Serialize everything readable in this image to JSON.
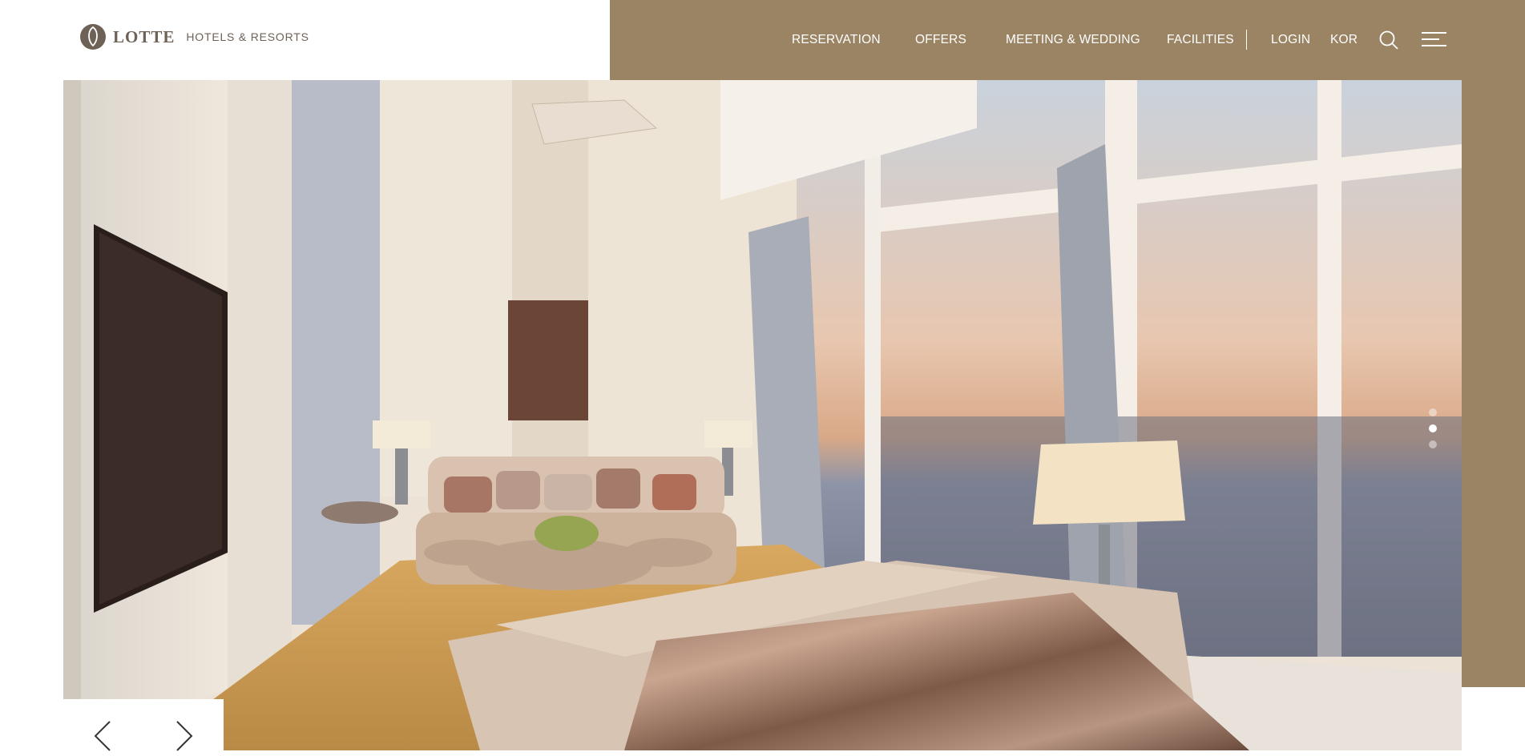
{
  "brand": {
    "name_main": "LOTTE",
    "name_sub": "HOTELS & RESORTS",
    "colors": {
      "panel": "#9b8464",
      "logo": "#6e6257",
      "text_on_panel": "#ffffff"
    }
  },
  "nav": {
    "items": [
      {
        "label": "RESERVATION"
      },
      {
        "label": "OFFERS"
      },
      {
        "label": "MEETING & WEDDING"
      },
      {
        "label": "FACILITIES"
      }
    ],
    "login": "LOGIN",
    "language": "KOR",
    "icons": {
      "search": "search-icon",
      "menu": "hamburger-menu-icon"
    }
  },
  "hero": {
    "image": "hotel-suite-living-room-photo",
    "slider": {
      "total": 3,
      "active": 2
    },
    "icons": {
      "prev": "arrow-left-icon",
      "next": "arrow-right-icon"
    }
  }
}
